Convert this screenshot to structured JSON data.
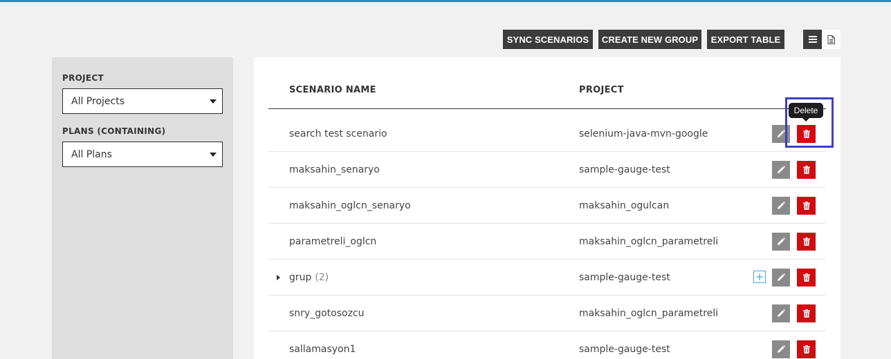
{
  "toolbar": {
    "sync_label": "SYNC SCENARIOS",
    "create_group_label": "CREATE NEW GROUP",
    "export_label": "EXPORT TABLE",
    "list_view_icon": "list-icon",
    "doc_view_icon": "document-icon"
  },
  "sidebar": {
    "project_label": "PROJECT",
    "project_value": "All Projects",
    "plans_label": "PLANS (CONTAINING)",
    "plans_value": "All Plans"
  },
  "table": {
    "columns": [
      "SCENARIO NAME",
      "PROJECT"
    ],
    "rows": [
      {
        "name": "search test scenario",
        "project": "selenium-java-mvn-google"
      },
      {
        "name": "maksahin_senaryo",
        "project": "sample-gauge-test"
      },
      {
        "name": "maksahin_oglcn_senaryo",
        "project": "maksahin_ogulcan"
      },
      {
        "name": "parametreli_oglcn",
        "project": "maksahin_oglcn_parametreli"
      },
      {
        "name": "grup",
        "count": "(2)",
        "project": "sample-gauge-test",
        "is_group": true
      },
      {
        "name": "snry_gotosozcu",
        "project": "maksahin_oglcn_parametreli"
      },
      {
        "name": "sallamasyon1",
        "project": "sample-gauge-test"
      }
    ]
  },
  "tooltip": {
    "text": "Delete"
  },
  "colors": {
    "accent": "#1a8fd6",
    "delete": "#d20a11",
    "edit": "#8a8a8a",
    "dark": "#3c3c3c",
    "highlight": "#3d3fc0"
  }
}
